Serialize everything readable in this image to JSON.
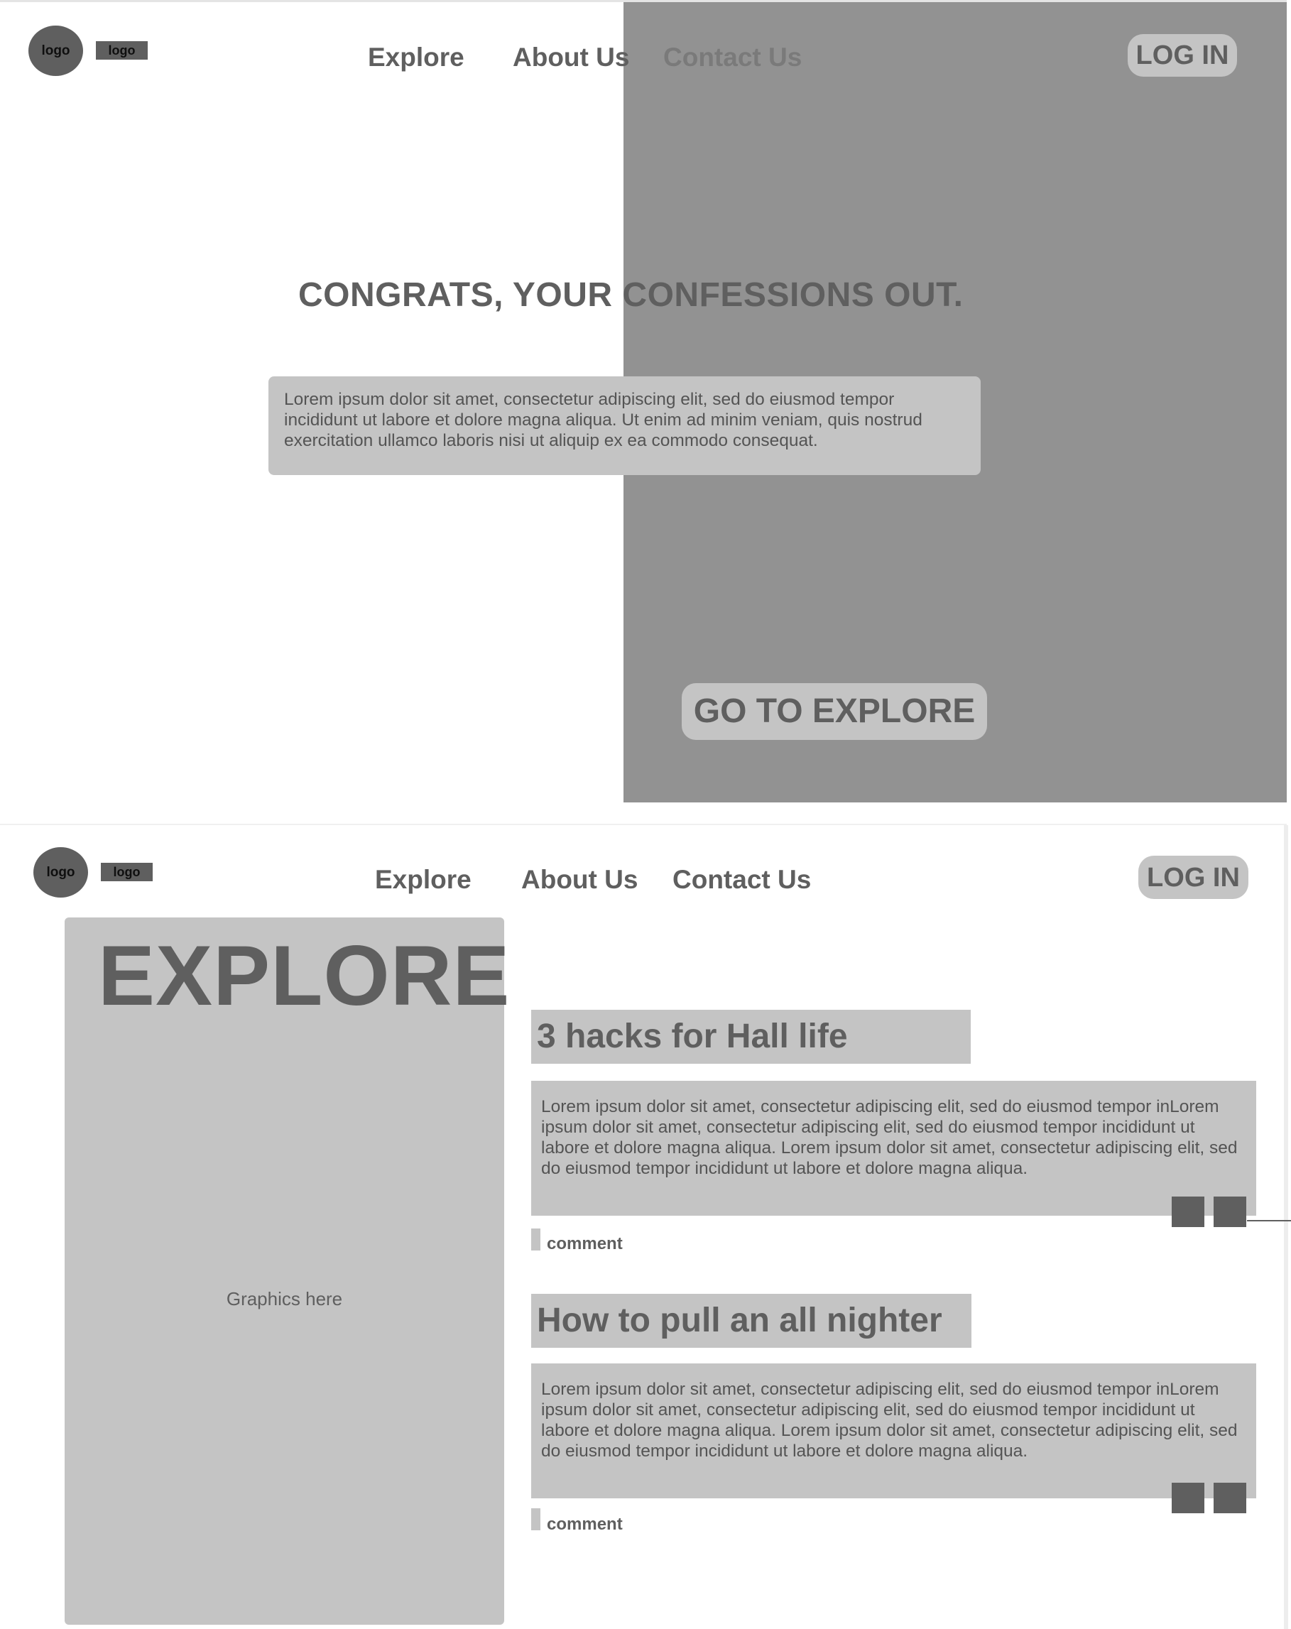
{
  "nav": {
    "logo_circle": "logo",
    "logo_rect": "logo",
    "explore": "Explore",
    "about": "About Us",
    "contact": "Contact Us",
    "login": "LOG IN"
  },
  "confession": {
    "heading": "CONGRATS, YOUR CONFESSIONS  OUT.",
    "body": "Lorem ipsum dolor sit amet, consectetur adipiscing elit, sed do eiusmod tempor incididunt ut labore et dolore magna aliqua. Ut enim ad minim veniam, quis nostrud exercitation ullamco laboris nisi ut aliquip ex ea commodo consequat.",
    "cta": "GO TO EXPLORE"
  },
  "explore": {
    "title": "EXPLORE",
    "graphics_placeholder": "Graphics here",
    "posts": [
      {
        "title": "3 hacks for Hall life",
        "body": "Lorem ipsum dolor sit amet, consectetur adipiscing elit, sed do eiusmod tempor inLorem ipsum dolor sit amet, consectetur adipiscing elit, sed do eiusmod tempor incididunt ut labore et dolore magna aliqua. Lorem ipsum dolor sit amet, consectetur adipiscing elit, sed do eiusmod tempor incididunt ut labore et dolore magna aliqua.",
        "comment": "comment"
      },
      {
        "title": "How to pull an all nighter",
        "body": "Lorem ipsum dolor sit amet, consectetur adipiscing elit, sed do eiusmod tempor inLorem ipsum dolor sit amet, consectetur adipiscing elit, sed do eiusmod tempor incididunt ut labore et dolore magna aliqua. Lorem ipsum dolor sit amet, consectetur adipiscing elit, sed do eiusmod tempor incididunt ut labore et dolore magna aliqua.",
        "comment": "comment"
      }
    ]
  },
  "colors": {
    "background": "#ffffff",
    "panel_light": "#c4c4c4",
    "panel_dark": "#929292",
    "text": "#5f5f5f"
  }
}
